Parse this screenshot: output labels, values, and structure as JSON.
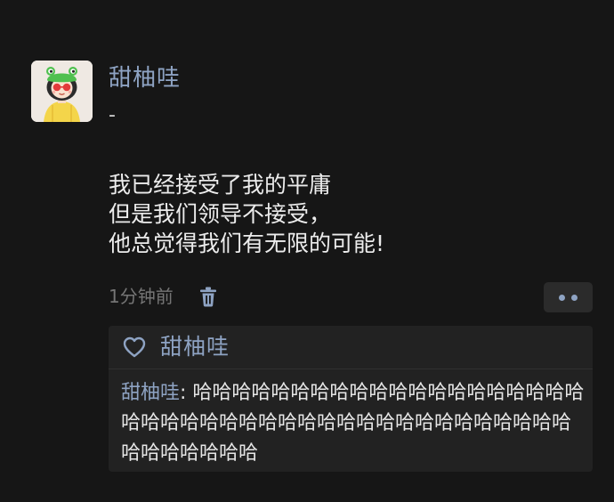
{
  "post": {
    "username": "甜柚哇",
    "subtitle": "-",
    "lines": [
      "我已经接受了我的平庸",
      "但是我们领导不接受，",
      "他总觉得我们有无限的可能!"
    ],
    "timestamp": "1分钟前"
  },
  "likes": {
    "names": "甜柚哇"
  },
  "comment": {
    "author": "甜柚哇",
    "separator": ": ",
    "text": "哈哈哈哈哈哈哈哈哈哈哈哈哈哈哈哈哈哈哈哈哈哈哈哈哈哈哈哈哈哈哈哈哈哈哈哈哈哈哈哈哈哈哈哈哈哈哈哈哈哈"
  },
  "icons": {
    "avatar": "cartoon-girl-frog-hat-avatar",
    "delete": "trash-icon",
    "more": "more-dots-icon",
    "like": "heart-icon"
  },
  "colors": {
    "background": "#161616",
    "link_blue": "#8ea3c3",
    "panel": "#222222",
    "muted": "#757575"
  }
}
